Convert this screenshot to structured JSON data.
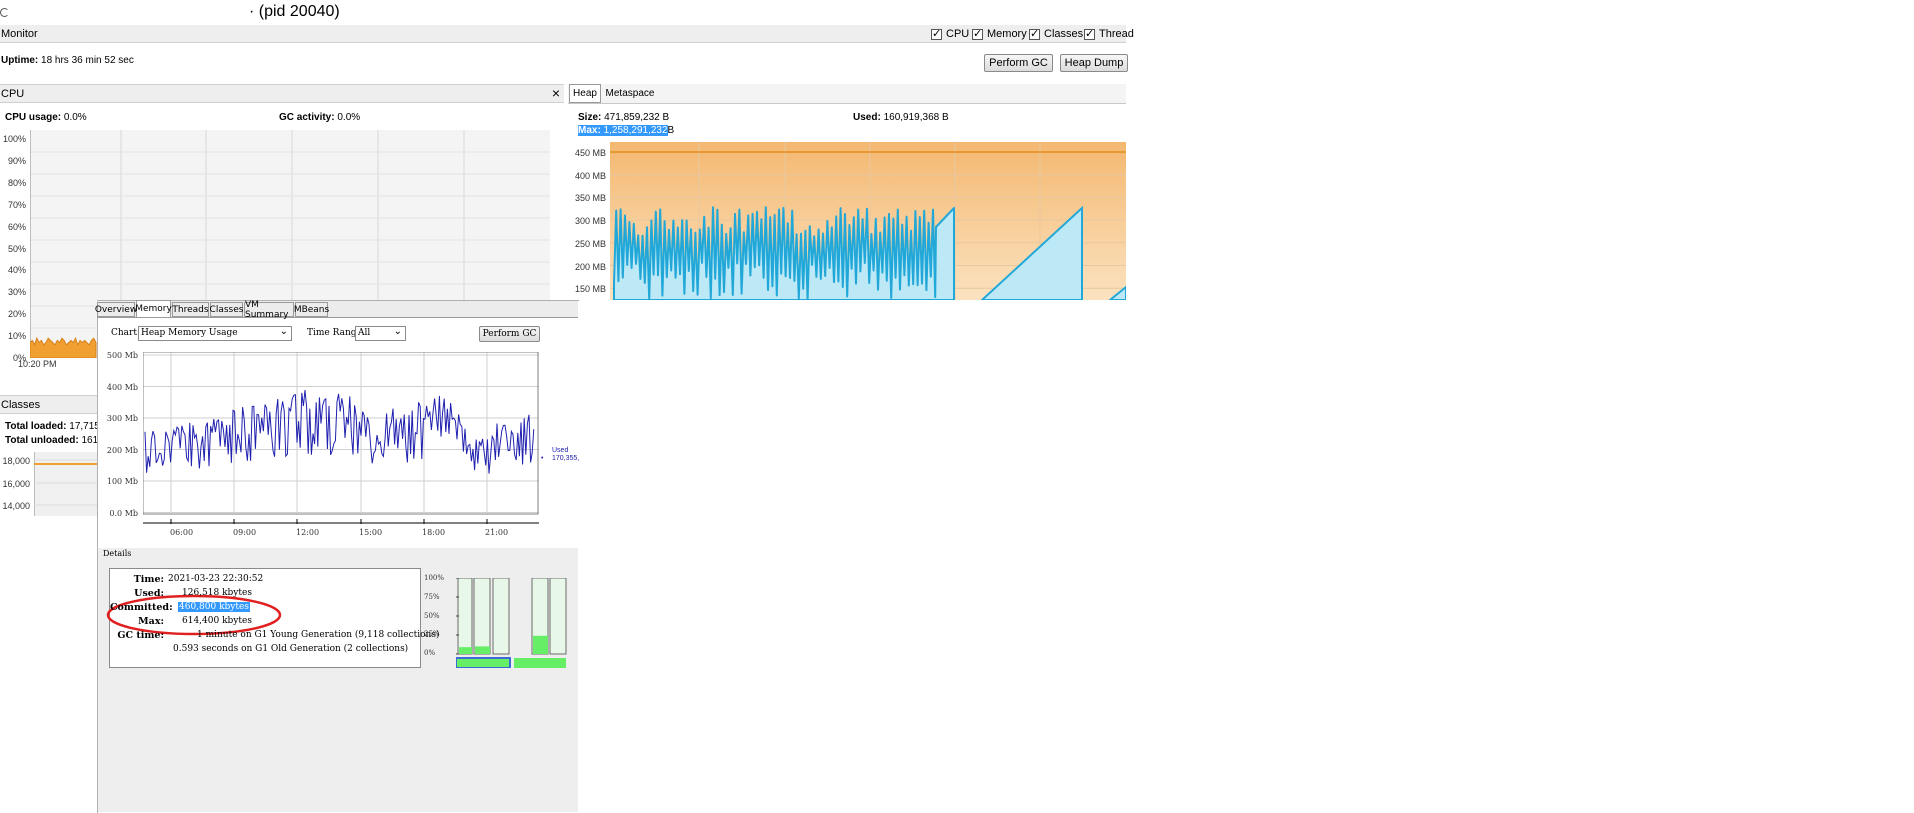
{
  "window": {
    "title": "· (pid 20040)"
  },
  "monitor": {
    "header": "Monitor",
    "uptime_label": "Uptime:",
    "uptime_value": "18 hrs 36 min 52 sec",
    "checkboxes": [
      {
        "label": "CPU",
        "checked": true
      },
      {
        "label": "Memory",
        "checked": true
      },
      {
        "label": "Classes",
        "checked": true
      },
      {
        "label": "Thread",
        "checked": true
      }
    ],
    "perform_gc": "Perform GC",
    "heap_dump": "Heap Dump"
  },
  "cpu": {
    "header": "CPU",
    "close": "×",
    "usage_label": "CPU usage:",
    "usage_value": "0.0%",
    "gc_label": "GC activity:",
    "gc_value": "0.0%",
    "y_ticks": [
      "100%",
      "90%",
      "80%",
      "70%",
      "60%",
      "50%",
      "40%",
      "30%",
      "20%",
      "10%",
      "0%"
    ],
    "x_tick": "10:20 PM",
    "color": "#f0a030"
  },
  "heap": {
    "tabs": [
      "Heap",
      "Metaspace"
    ],
    "size_label": "Size:",
    "size_value": "471,859,232 B",
    "used_label": "Used:",
    "used_value": "160,919,368 B",
    "max_label": "Max:",
    "max_value": "1,258,291,232",
    "max_suffix": "B",
    "y_ticks": [
      "450 MB",
      "400 MB",
      "350 MB",
      "300 MB",
      "250 MB",
      "200 MB",
      "150 MB"
    ],
    "fill_color": "#f8d0a0",
    "line_color": "#22a8d8"
  },
  "classes": {
    "header": "Classes",
    "loaded_label": "Total loaded:",
    "loaded_value": "17,715",
    "unloaded_label": "Total unloaded:",
    "unloaded_value": "161",
    "y_ticks": [
      "18,000",
      "16,000",
      "14,000"
    ]
  },
  "jconsole": {
    "tabs": [
      "Overview",
      "Memory",
      "Threads",
      "Classes",
      "VM Summary",
      "MBeans"
    ],
    "active_tab": "Memory",
    "chart_label": "Chart:",
    "chart_value": "Heap Memory Usage",
    "range_label": "Time Range:",
    "range_value": "All",
    "perform_gc": "Perform GC",
    "y_ticks": [
      "500 Mb",
      "400 Mb",
      "300 Mb",
      "200 Mb",
      "100 Mb",
      "0.0 Mb"
    ],
    "x_ticks": [
      "06:00",
      "09:00",
      "12:00",
      "15:00",
      "18:00",
      "21:00"
    ],
    "legend_label": "Used",
    "legend_value": "170,355,",
    "line_color": "#2020b0"
  },
  "details": {
    "header": "Details",
    "rows": [
      {
        "label": "Time:",
        "value": "2021-03-23 22:30:52"
      },
      {
        "label": "Used:",
        "value": "126,518 kbytes"
      },
      {
        "label": "Committed:",
        "value": "460,800 kbytes"
      },
      {
        "label": "Max:",
        "value": "614,400 kbytes"
      },
      {
        "label": "GC time:",
        "value": "1 minute on G1 Young Generation (9,118 collections)"
      }
    ],
    "gc_old": "0.593 seconds on G1 Old Generation (2 collections)",
    "bar_ticks": [
      "100%",
      "75%",
      "50%",
      "25%",
      "0%"
    ],
    "highlight_color": "#3399ff",
    "annotation_color": "#e02020"
  },
  "chart_data": [
    {
      "type": "area",
      "title": "CPU",
      "series": [
        {
          "name": "CPU usage",
          "values": [
            7,
            8,
            6,
            9,
            7,
            8,
            6,
            7,
            9,
            8,
            7,
            6,
            8,
            7,
            9,
            8,
            6,
            7,
            8,
            7,
            9,
            6,
            8,
            7,
            8,
            7,
            6,
            8,
            9,
            7
          ]
        }
      ],
      "ylim": [
        0,
        100
      ]
    },
    {
      "type": "area",
      "title": "Heap",
      "series": [
        {
          "name": "Size",
          "values": [
            450
          ]
        },
        {
          "name": "Used",
          "values": [
            150,
            320,
            150,
            310,
            150,
            330,
            150,
            300,
            150,
            325,
            150,
            310,
            150,
            330,
            150,
            300,
            150,
            320,
            150,
            325,
            150,
            310,
            150,
            330,
            150,
            300,
            150,
            320,
            150,
            330
          ]
        }
      ],
      "ylim": [
        150,
        450
      ]
    },
    {
      "type": "line",
      "title": "Heap Memory Usage",
      "x": [
        "06:00",
        "09:00",
        "12:00",
        "15:00",
        "18:00",
        "21:00"
      ],
      "series": [
        {
          "name": "Used",
          "values": [
            120,
            210,
            170,
            250,
            200,
            330,
            260,
            390,
            360,
            410,
            220,
            380,
            200,
            350,
            270,
            390,
            230,
            400,
            190,
            350,
            180,
            410,
            250,
            380,
            170,
            320,
            150,
            340,
            190,
            300
          ]
        }
      ],
      "ylim": [
        0,
        500
      ]
    },
    {
      "type": "line",
      "title": "Classes",
      "series": [
        {
          "name": "Total loaded",
          "values": [
            17715,
            17715
          ]
        }
      ],
      "ylim": [
        14000,
        18000
      ]
    }
  ]
}
